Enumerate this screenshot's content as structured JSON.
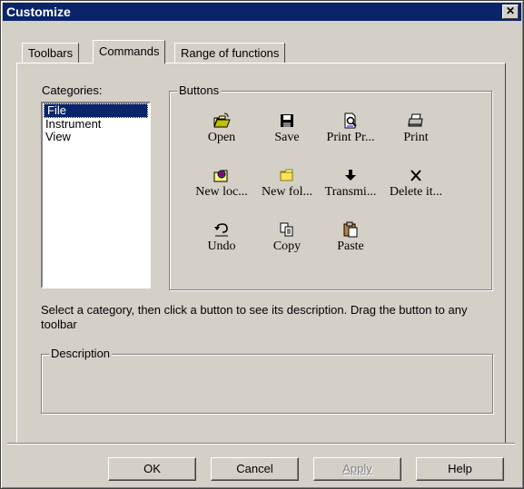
{
  "window": {
    "title": "Customize"
  },
  "tabs": [
    {
      "label": "Toolbars"
    },
    {
      "label": "Commands"
    },
    {
      "label": "Range of functions"
    }
  ],
  "categories": {
    "label": "Categories:",
    "items": [
      {
        "label": "File",
        "selected": true
      },
      {
        "label": "Instrument"
      },
      {
        "label": "View"
      }
    ]
  },
  "buttons": {
    "label": "Buttons",
    "items": [
      {
        "label": "Open",
        "icon": "open-folder-icon"
      },
      {
        "label": "Save",
        "icon": "floppy-disk-icon"
      },
      {
        "label": "Print Pr...",
        "icon": "print-preview-icon"
      },
      {
        "label": "Print",
        "icon": "printer-icon"
      },
      {
        "label": "New loc...",
        "icon": "new-location-icon"
      },
      {
        "label": "New fol...",
        "icon": "new-folder-icon"
      },
      {
        "label": "Transmi...",
        "icon": "down-arrow-icon"
      },
      {
        "label": "Delete it...",
        "icon": "delete-x-icon"
      },
      {
        "label": "Undo",
        "icon": "undo-icon"
      },
      {
        "label": "Copy",
        "icon": "copy-icon"
      },
      {
        "label": "Paste",
        "icon": "paste-icon"
      }
    ]
  },
  "instructions": "Select a category, then click a button to see its description. Drag the button to any toolbar",
  "description": {
    "label": "Description",
    "text": ""
  },
  "footer": {
    "ok": "OK",
    "cancel": "Cancel",
    "apply": "Apply",
    "help": "Help"
  },
  "colors": {
    "title_bar": "#0a246a",
    "face": "#d4d0c8",
    "selection": "#0a246a"
  }
}
